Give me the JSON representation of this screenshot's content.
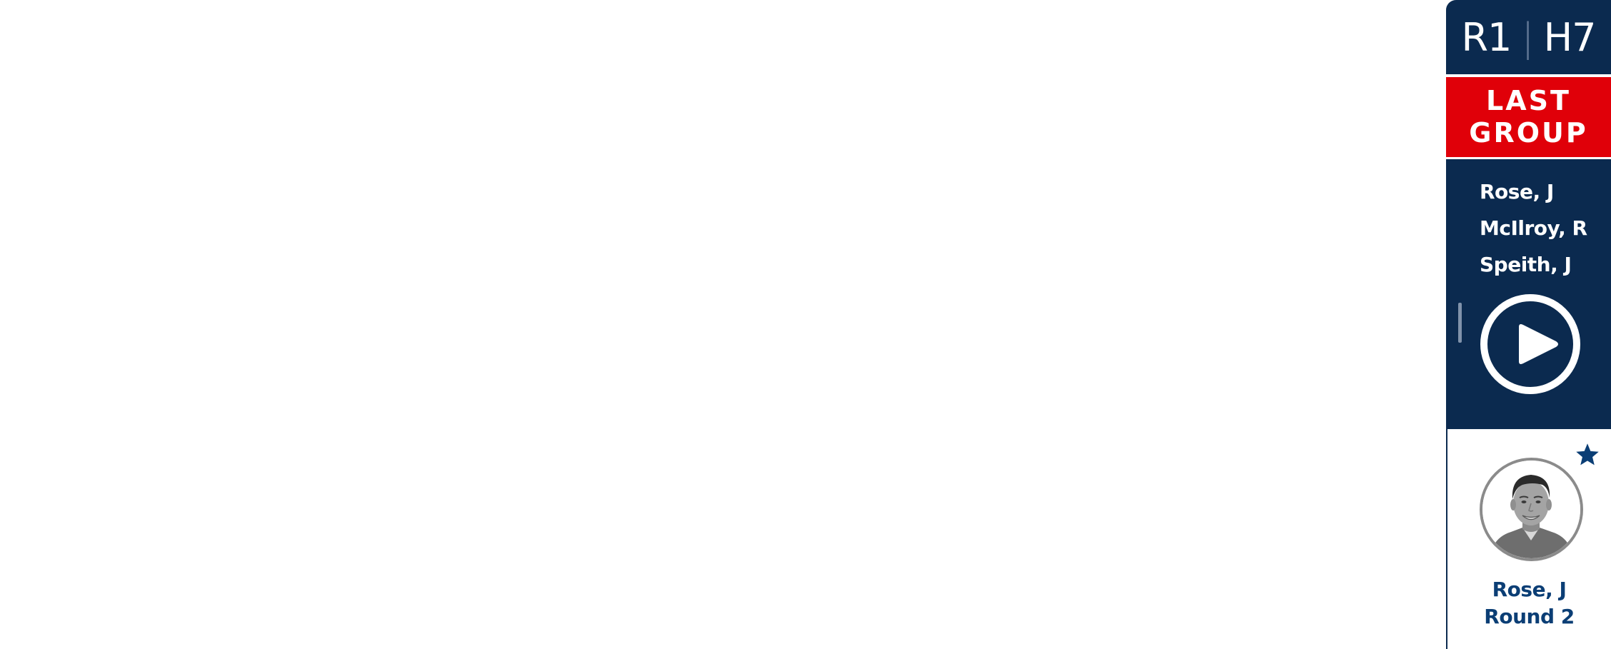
{
  "header": {
    "round": "R1",
    "separator": "|",
    "hole": "H7"
  },
  "badge": {
    "line1": "LAST",
    "line2": "GROUP"
  },
  "group": {
    "players": [
      "Rose, J",
      "McIlroy, R",
      "Speith, J"
    ]
  },
  "play": {
    "icon": "play-icon"
  },
  "profile": {
    "name": "Rose, J",
    "round": "Round 2",
    "favorite_icon": "star-icon"
  },
  "colors": {
    "navy": "#0b2a4f",
    "red": "#e00009",
    "name_blue": "#0b3e75"
  }
}
